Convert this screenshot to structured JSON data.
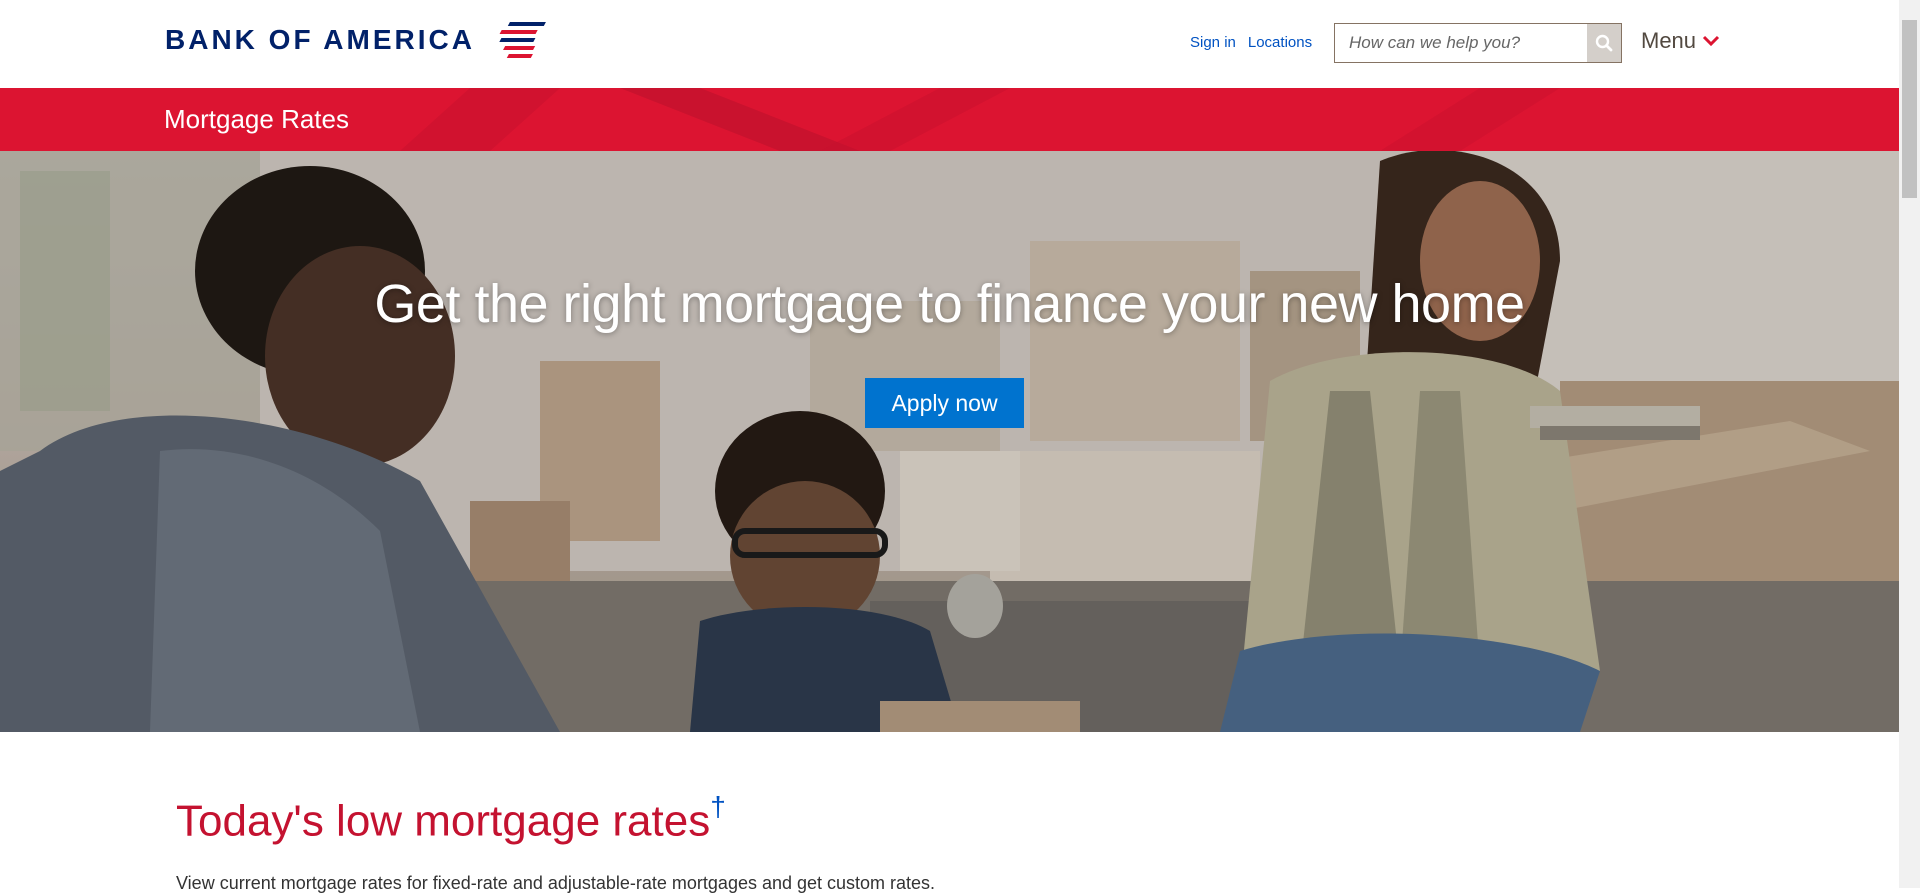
{
  "header": {
    "logo_text": "BANK OF AMERICA",
    "sign_in": "Sign in",
    "locations": "Locations",
    "search_placeholder": "How can we help you?",
    "menu_label": "Menu"
  },
  "band": {
    "title": "Mortgage Rates"
  },
  "hero": {
    "headline": "Get the right mortgage to finance your new home",
    "apply_label": "Apply now"
  },
  "content": {
    "heading": "Today's low mortgage rates",
    "heading_marker": "†",
    "intro": "View current mortgage rates for fixed-rate and adjustable-rate mortgages and get custom rates."
  },
  "colors": {
    "brand_navy": "#012169",
    "brand_red": "#dc1431",
    "link_blue": "#0052c2",
    "cta_blue": "#0073cf",
    "heading_red": "#c41230"
  },
  "icons": {
    "logo": "flag-stripes-icon",
    "search": "search-icon",
    "menu": "chevron-down-icon"
  }
}
